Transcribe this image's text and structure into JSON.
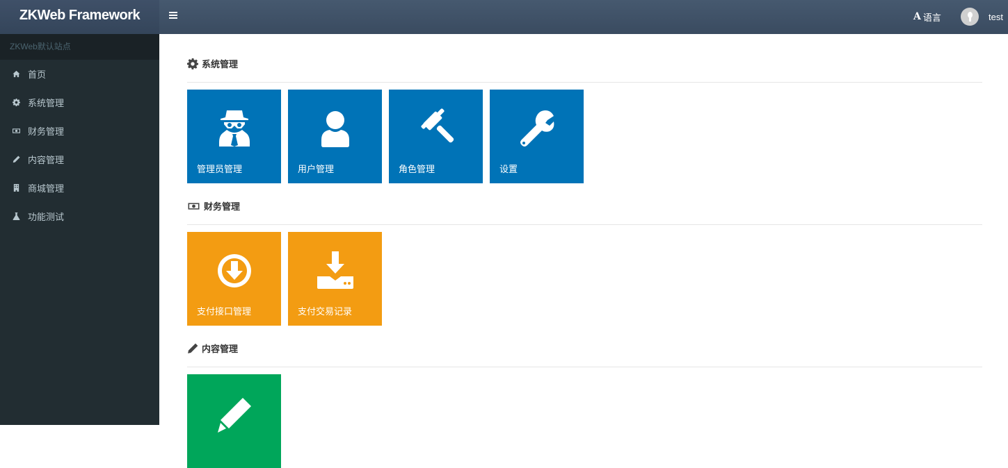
{
  "header": {
    "brand": "ZKWeb Framework",
    "language_label": "语言",
    "language_icon_glyph": "A",
    "username": "test"
  },
  "sidebar": {
    "site_name": "ZKWeb默认站点",
    "items": [
      {
        "label": "首页",
        "icon": "home-icon"
      },
      {
        "label": "系统管理",
        "icon": "gear-icon"
      },
      {
        "label": "财务管理",
        "icon": "money-icon"
      },
      {
        "label": "内容管理",
        "icon": "pencil-icon"
      },
      {
        "label": "商城管理",
        "icon": "building-icon"
      },
      {
        "label": "功能测试",
        "icon": "flask-icon"
      }
    ]
  },
  "sections": [
    {
      "title": "系统管理",
      "icon": "gear-icon",
      "tiles": [
        {
          "label": "管理员管理",
          "icon": "user-secret-icon",
          "color": "#0073b7"
        },
        {
          "label": "用户管理",
          "icon": "user-icon",
          "color": "#0073b7"
        },
        {
          "label": "角色管理",
          "icon": "gavel-icon",
          "color": "#0073b7"
        },
        {
          "label": "设置",
          "icon": "wrench-icon",
          "color": "#0073b7"
        }
      ]
    },
    {
      "title": "财务管理",
      "icon": "money-icon",
      "tiles": [
        {
          "label": "支付接口管理",
          "icon": "arrow-circle-down-icon",
          "color": "#f39c12"
        },
        {
          "label": "支付交易记录",
          "icon": "download-icon",
          "color": "#f39c12"
        }
      ]
    },
    {
      "title": "内容管理",
      "icon": "pencil-icon",
      "tiles": [
        {
          "label": "",
          "icon": "pencil-icon",
          "color": "#00a65a"
        }
      ]
    }
  ]
}
